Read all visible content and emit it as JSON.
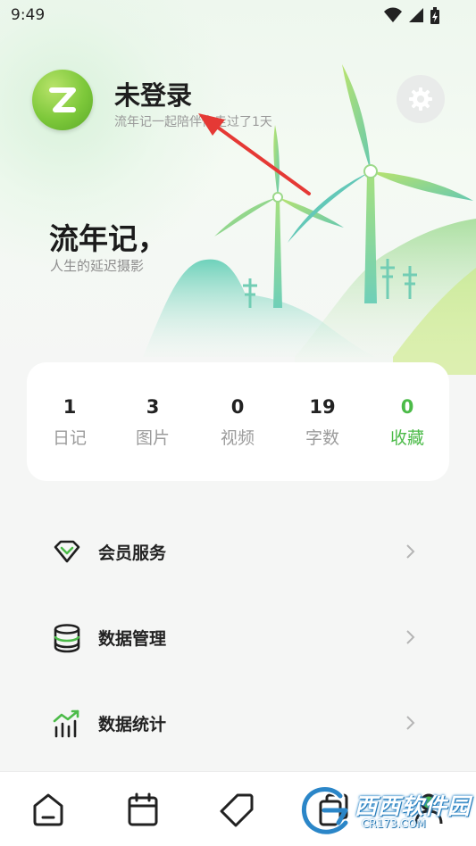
{
  "status_bar": {
    "time": "9:49"
  },
  "profile": {
    "name": "未登录",
    "subtitle": "流年记一起陪伴你走过了1天"
  },
  "slogan": {
    "title": "流年记，",
    "subtitle": "人生的延迟摄影"
  },
  "stats": [
    {
      "value": "1",
      "label": "日记"
    },
    {
      "value": "3",
      "label": "图片"
    },
    {
      "value": "0",
      "label": "视频"
    },
    {
      "value": "19",
      "label": "字数"
    },
    {
      "value": "0",
      "label": "收藏"
    }
  ],
  "menu": [
    {
      "label": "会员服务",
      "icon": "diamond-icon"
    },
    {
      "label": "数据管理",
      "icon": "database-icon"
    },
    {
      "label": "数据统计",
      "icon": "chart-icon"
    }
  ],
  "bottom_nav": [
    {
      "icon": "home-icon"
    },
    {
      "icon": "calendar-icon"
    },
    {
      "icon": "tag-icon"
    },
    {
      "icon": "cards-icon"
    },
    {
      "icon": "profile-icon"
    }
  ],
  "watermark": {
    "text": "西西软件园",
    "url": "CR173.COM"
  },
  "colors": {
    "accent": "#4cbb49",
    "background": "#f5f6f5",
    "card": "#ffffff",
    "arrow": "#e53935"
  }
}
